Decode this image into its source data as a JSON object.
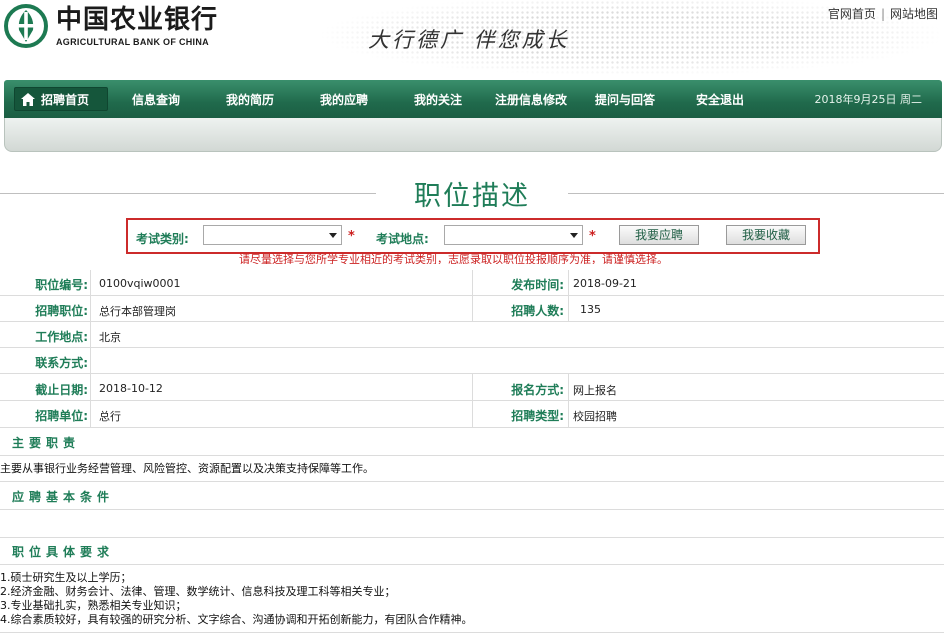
{
  "header": {
    "bank_name_cn": "中国农业银行",
    "bank_name_en": "AGRICULTURAL BANK OF CHINA",
    "slogan": "大行德广  伴您成长",
    "links": [
      "官网首页",
      "网站地图"
    ],
    "link_separator": "|"
  },
  "nav": {
    "home": "招聘首页",
    "items": [
      "信息查询",
      "我的简历",
      "我的应聘",
      "我的关注",
      "注册信息修改",
      "提问与回答",
      "安全退出"
    ],
    "date": "2018年9月25日 周二"
  },
  "page_title": "职位描述",
  "filter": {
    "exam_type_label": "考试类别:",
    "exam_location_label": "考试地点:",
    "required_mark": "*",
    "apply_button": "我要应聘",
    "favorite_button": "我要收藏",
    "hint": "请尽量选择与您所学专业相近的考试类别，志愿录取以职位投报顺序为准，请谨慎选择。"
  },
  "details": {
    "job_id_label": "职位编号:",
    "job_id": "0100vqiw0001",
    "publish_label": "发布时间:",
    "publish": "2018-09-21",
    "position_label": "招聘职位:",
    "position": "总行本部管理岗",
    "count_label": "招聘人数:",
    "count": "135",
    "location_label": "工作地点:",
    "location": "北京",
    "contact_label": "联系方式:",
    "contact": "",
    "deadline_label": "截止日期:",
    "deadline": "2018-10-12",
    "signup_label": "报名方式:",
    "signup": "网上报名",
    "unit_label": "招聘单位:",
    "unit": "总行",
    "type_label": "招聘类型:",
    "type": "校园招聘"
  },
  "sections": {
    "duties_head": "主要职责",
    "duties_text": "主要从事银行业务经营管理、风险管控、资源配置以及决策支持保障等工作。",
    "basic_head": "应聘基本条件",
    "req_head": "职位具体要求",
    "requirements": [
      "1.硕士研究生及以上学历；",
      "2.经济金融、财务会计、法律、管理、数学统计、信息科技及理工科等相关专业；",
      "3.专业基础扎实，熟悉相关专业知识；",
      "4.综合素质较好，具有较强的研究分析、文字综合、沟通协调和开拓创新能力，有团队合作精神。"
    ]
  },
  "colors": {
    "brand_green": "#1f7d58",
    "nav_green": "#206a4c",
    "alert_red": "#cc2b2b"
  }
}
